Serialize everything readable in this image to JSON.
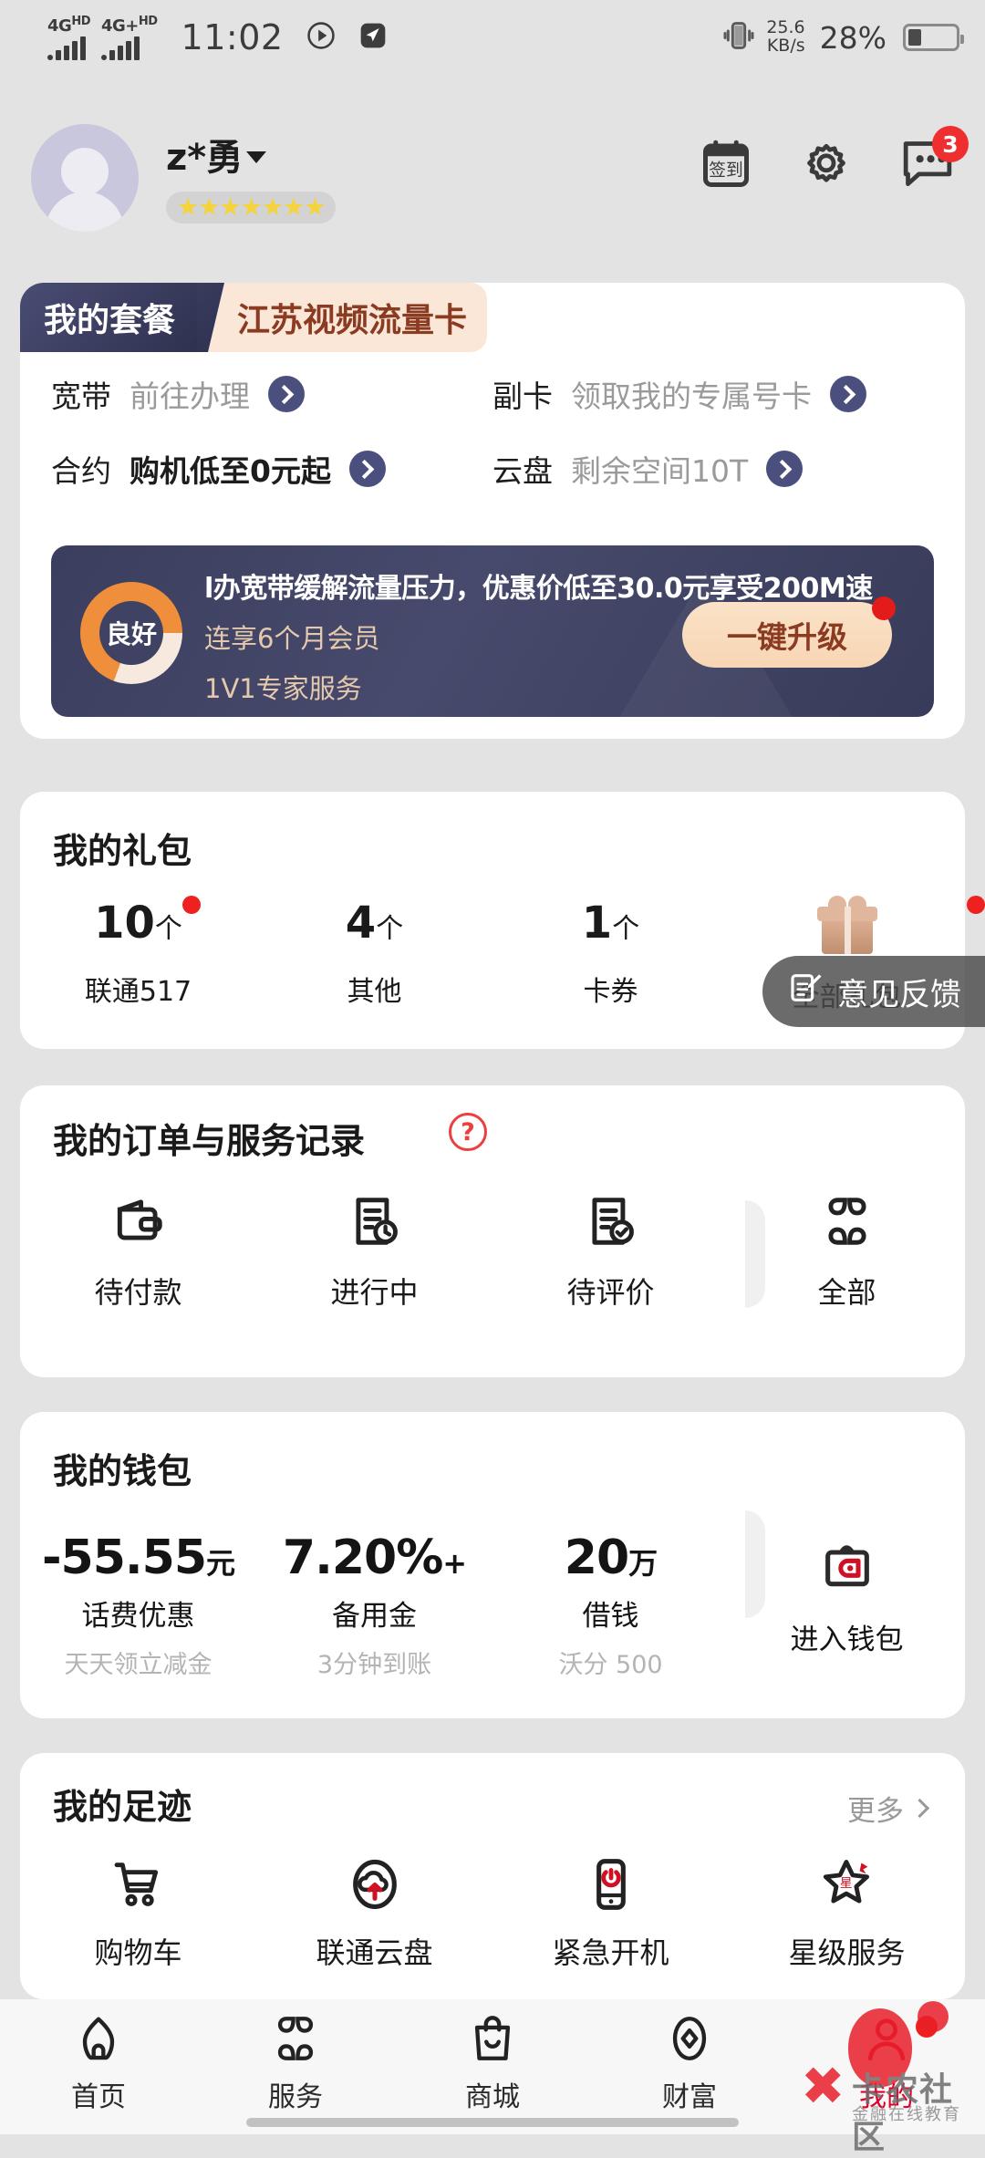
{
  "status_bar": {
    "net1": "4G",
    "net1_sup": "HD",
    "net2": "4G+",
    "net2_sup": "HD",
    "time": "11:02",
    "speed_value": "25.6",
    "speed_unit": "KB/s",
    "battery_percent": "28%"
  },
  "profile": {
    "username": "z*勇",
    "stars": "★★★★★★★",
    "icons": {
      "checkin_label": "签到",
      "settings": "gear-icon",
      "messages": "message-icon",
      "message_badge": "3"
    }
  },
  "package": {
    "tab_main": "我的套餐",
    "tab_sub": "江苏视频流量卡",
    "items": [
      {
        "key": "宽带",
        "value": "前往办理",
        "emphasis": false
      },
      {
        "key": "副卡",
        "value": "领取我的专属号卡",
        "emphasis": false
      },
      {
        "key": "合约",
        "value": "购机低至0元起",
        "emphasis": true
      },
      {
        "key": "云盘",
        "value": "剩余空间10T",
        "emphasis": false
      }
    ],
    "banner": {
      "ring_label": "良好",
      "line1": "l办宽带缓解流量压力，优惠价低至30.0元享受200M速",
      "line2": "连享6个月会员",
      "line3": "1V1专家服务",
      "button": "一键升级"
    }
  },
  "gift": {
    "title": "我的礼包",
    "items": [
      {
        "num": "10",
        "unit": "个",
        "label": "联通517",
        "dot": true
      },
      {
        "num": "4",
        "unit": "个",
        "label": "其他",
        "dot": false
      },
      {
        "num": "1",
        "unit": "个",
        "label": "卡券",
        "dot": false
      }
    ],
    "all_label": "全部礼包"
  },
  "orders": {
    "title": "我的订单与服务记录",
    "help": "?",
    "items": [
      {
        "label": "待付款",
        "icon": "wallet-icon"
      },
      {
        "label": "进行中",
        "icon": "doc-clock-icon"
      },
      {
        "label": "待评价",
        "icon": "doc-check-icon"
      },
      {
        "label": "全部",
        "icon": "grid-icon"
      }
    ]
  },
  "wallet": {
    "title": "我的钱包",
    "items": [
      {
        "num": "-55.55",
        "unit": "元",
        "label": "话费优惠",
        "sub": "天天领立减金"
      },
      {
        "num": "7.20%",
        "unit": "+",
        "label": "备用金",
        "sub": "3分钟到账"
      },
      {
        "num": "20",
        "unit": "万",
        "label": "借钱",
        "sub": "沃分 500"
      }
    ],
    "enter_label": "进入钱包"
  },
  "footprint": {
    "title": "我的足迹",
    "more": "更多",
    "items": [
      {
        "label": "购物车",
        "icon": "cart-icon"
      },
      {
        "label": "联通云盘",
        "icon": "cloud-upload-icon"
      },
      {
        "label": "紧急开机",
        "icon": "power-phone-icon"
      },
      {
        "label": "星级服务",
        "icon": "star-service-icon"
      }
    ],
    "page_dots": 2,
    "page_active": 0
  },
  "feedback": {
    "label": "意见反馈"
  },
  "tabbar": {
    "tabs": [
      {
        "label": "首页",
        "icon": "home-icon",
        "active": false
      },
      {
        "label": "服务",
        "icon": "grid-icon",
        "active": false
      },
      {
        "label": "商城",
        "icon": "bag-icon",
        "active": false
      },
      {
        "label": "财富",
        "icon": "diamond-icon",
        "active": false
      },
      {
        "label": "我的",
        "icon": "person-icon",
        "active": true
      }
    ]
  },
  "watermark": {
    "x": "✖",
    "title": "卡农社区",
    "sub": "金融在线教育"
  },
  "colors": {
    "accent_red": "#e3002b",
    "brand_navy": "#2f3150",
    "brand_peach": "#fbe7d7",
    "orange": "#ef8f3c"
  }
}
